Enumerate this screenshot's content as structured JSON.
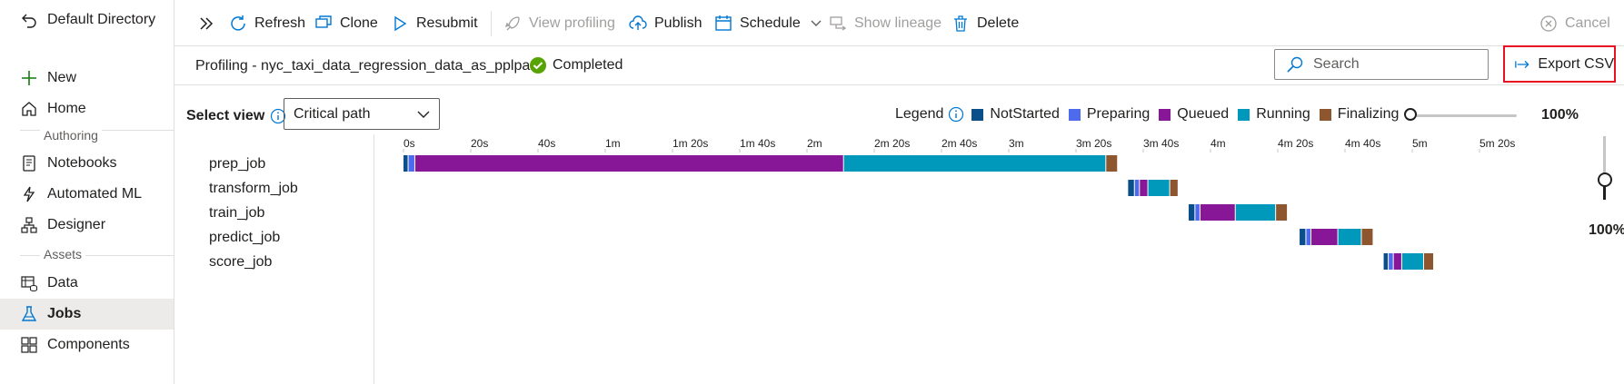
{
  "sidebar": {
    "directory": "Default Directory",
    "items": [
      {
        "label": "New",
        "icon": "plus-icon"
      },
      {
        "label": "Home",
        "icon": "home-icon"
      }
    ],
    "authoring_label": "Authoring",
    "authoring": [
      {
        "label": "Notebooks",
        "icon": "notebook-icon"
      },
      {
        "label": "Automated ML",
        "icon": "automl-icon"
      },
      {
        "label": "Designer",
        "icon": "designer-icon"
      }
    ],
    "assets_label": "Assets",
    "assets": [
      {
        "label": "Data",
        "icon": "data-icon"
      },
      {
        "label": "Jobs",
        "icon": "flask-icon",
        "active": true
      },
      {
        "label": "Components",
        "icon": "components-icon"
      }
    ]
  },
  "toolbar": {
    "refresh": "Refresh",
    "clone": "Clone",
    "resubmit": "Resubmit",
    "view_profiling": "View profiling",
    "publish": "Publish",
    "schedule": "Schedule",
    "show_lineage": "Show lineage",
    "delete": "Delete",
    "cancel": "Cancel"
  },
  "header": {
    "title": "Profiling - nyc_taxi_data_regression_data_as_pplpara",
    "status": "Completed",
    "search_placeholder": "Search",
    "export": "Export CSV"
  },
  "controls": {
    "select_view_label": "Select view",
    "select_view_value": "Critical path",
    "legend_title": "Legend",
    "legend": [
      {
        "label": "NotStarted",
        "color": "#0b4f8a"
      },
      {
        "label": "Preparing",
        "color": "#4f6bed"
      },
      {
        "label": "Queued",
        "color": "#881798"
      },
      {
        "label": "Running",
        "color": "#0099bc"
      },
      {
        "label": "Finalizing",
        "color": "#8e562e"
      }
    ],
    "horizontal_zoom": "100%",
    "vertical_zoom": "100%"
  },
  "timeline": {
    "ticks": [
      "0s",
      "20s",
      "40s",
      "1m",
      "1m 20s",
      "1m 40s",
      "2m",
      "2m 20s",
      "2m 40s",
      "3m",
      "3m 20s",
      "3m 40s",
      "4m",
      "4m 20s",
      "4m 40s",
      "5m",
      "5m 20s"
    ],
    "jobs": [
      {
        "name": "prep_job",
        "segments": [
          {
            "state": "NotStarted",
            "start": 0,
            "end": 1.5
          },
          {
            "state": "Preparing",
            "start": 1.5,
            "end": 3.5
          },
          {
            "state": "Queued",
            "start": 3.5,
            "end": 131
          },
          {
            "state": "Running",
            "start": 131,
            "end": 209
          },
          {
            "state": "Finalizing",
            "start": 209,
            "end": 212.5
          }
        ]
      },
      {
        "name": "transform_job",
        "segments": [
          {
            "state": "NotStarted",
            "start": 215.5,
            "end": 217.5
          },
          {
            "state": "Preparing",
            "start": 217.5,
            "end": 219
          },
          {
            "state": "Queued",
            "start": 219,
            "end": 221.5
          },
          {
            "state": "Running",
            "start": 221.5,
            "end": 228
          },
          {
            "state": "Finalizing",
            "start": 228,
            "end": 230.5
          }
        ]
      },
      {
        "name": "train_job",
        "segments": [
          {
            "state": "NotStarted",
            "start": 233.5,
            "end": 235.5
          },
          {
            "state": "Preparing",
            "start": 235.5,
            "end": 237
          },
          {
            "state": "Queued",
            "start": 237,
            "end": 247.5
          },
          {
            "state": "Running",
            "start": 247.5,
            "end": 259.5
          },
          {
            "state": "Finalizing",
            "start": 259.5,
            "end": 263
          }
        ]
      },
      {
        "name": "predict_job",
        "segments": [
          {
            "state": "NotStarted",
            "start": 266.5,
            "end": 268.5
          },
          {
            "state": "Preparing",
            "start": 268.5,
            "end": 270
          },
          {
            "state": "Queued",
            "start": 270,
            "end": 278
          },
          {
            "state": "Running",
            "start": 278,
            "end": 285
          },
          {
            "state": "Finalizing",
            "start": 285,
            "end": 288.5
          }
        ]
      },
      {
        "name": "score_job",
        "segments": [
          {
            "state": "NotStarted",
            "start": 291.5,
            "end": 293
          },
          {
            "state": "Preparing",
            "start": 293,
            "end": 294.5
          },
          {
            "state": "Queued",
            "start": 294.5,
            "end": 297
          },
          {
            "state": "Running",
            "start": 297,
            "end": 303.5
          },
          {
            "state": "Finalizing",
            "start": 303.5,
            "end": 306.5
          }
        ]
      }
    ]
  }
}
